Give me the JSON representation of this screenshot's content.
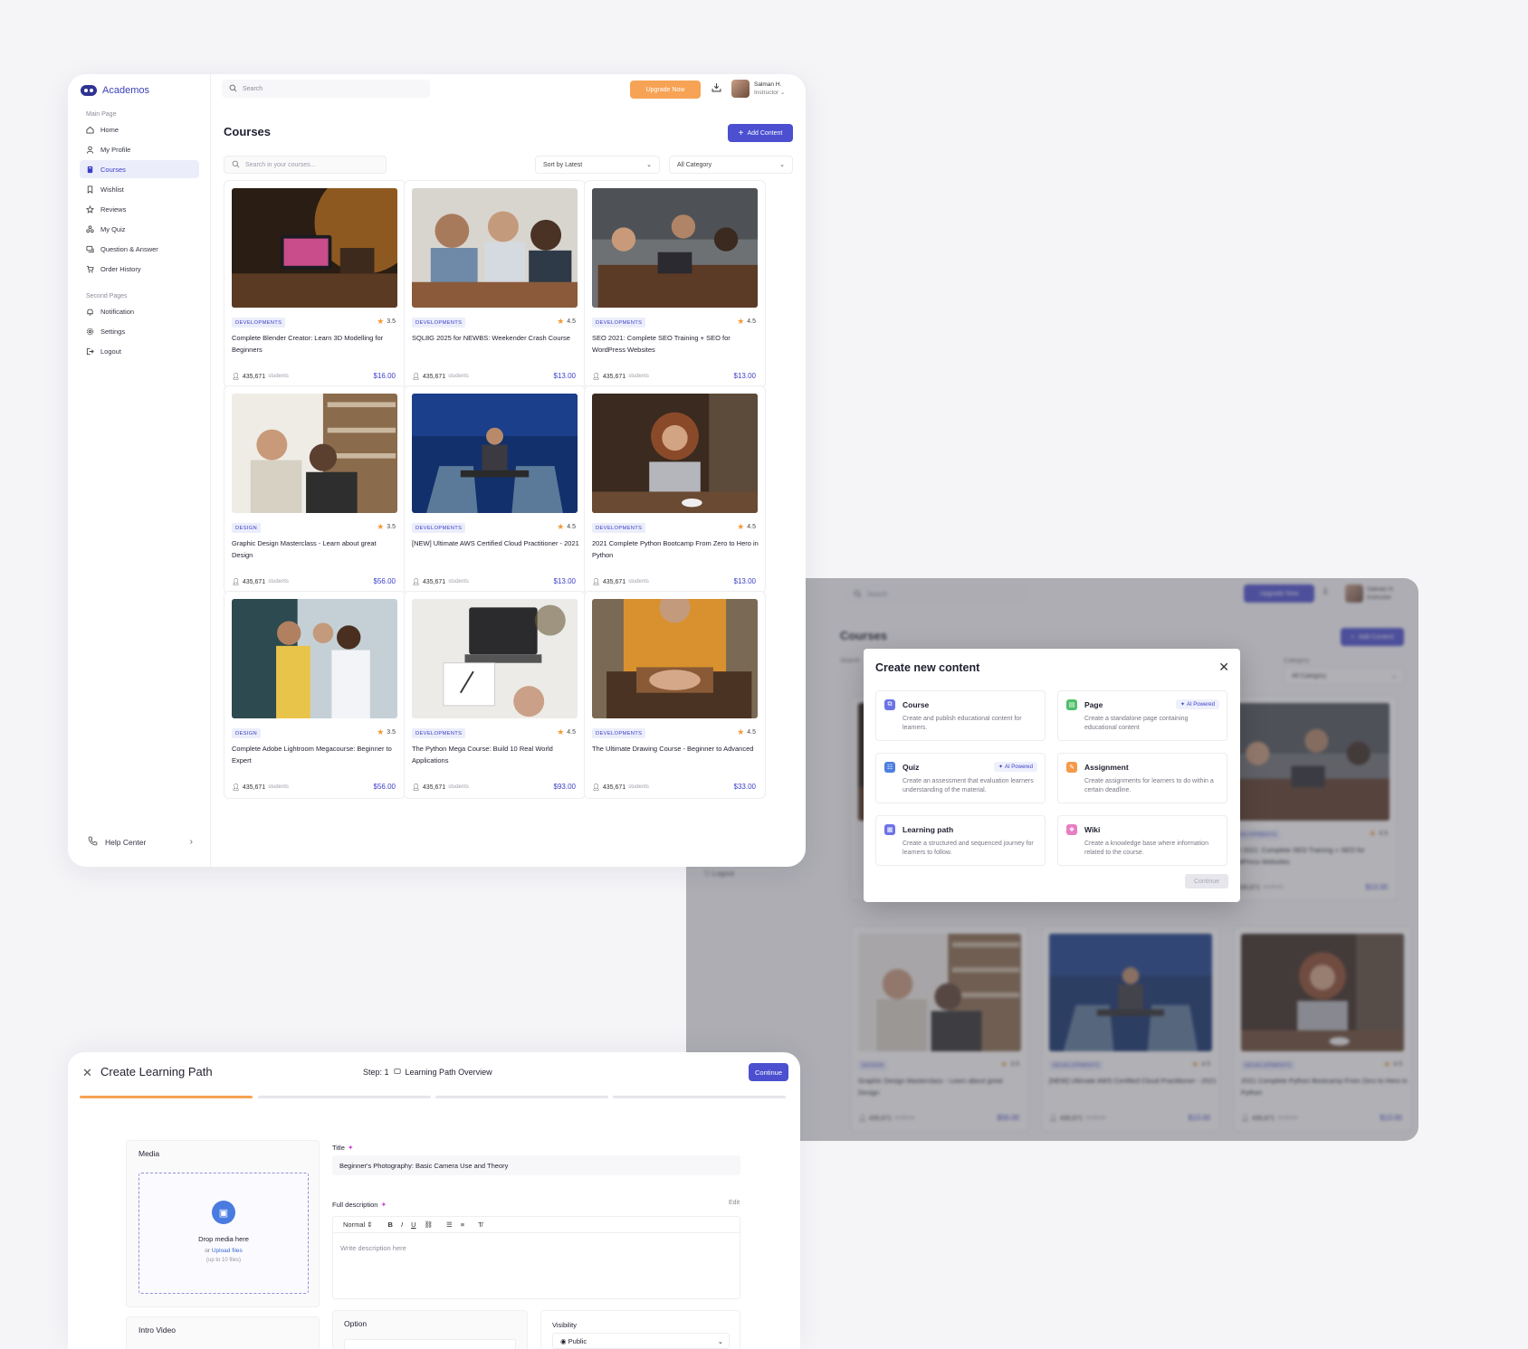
{
  "main": {
    "brand": "Academos",
    "search_placeholder": "Search",
    "upgrade_label": "Upgrade Now",
    "user": {
      "name": "Salman H.",
      "role": "Instructor"
    },
    "sections": {
      "main": "Main Page",
      "second": "Second Pages"
    },
    "nav": [
      "Home",
      "My Profile",
      "Courses",
      "Wishlist",
      "Reviews",
      "My Quiz",
      "Question & Answer",
      "Order History"
    ],
    "nav2": [
      "Notification",
      "Settings",
      "Logout"
    ],
    "help": "Help Center",
    "page_title": "Courses",
    "add_content": "Add Content",
    "course_search_placeholder": "Search in your courses...",
    "sort_label": "Sort by Latest",
    "category_label": "All Category",
    "students_word": "students",
    "courses": [
      {
        "tag": "DEVELOPMENTS",
        "rating": "3.5",
        "title": "Complete Blender Creator: Learn 3D Modelling for Beginners",
        "students": "435,671",
        "price": "$16.00"
      },
      {
        "tag": "DEVELOPMENTS",
        "rating": "4.5",
        "title": "SQL8G 2025 for NEWBS: Weekender Crash Course",
        "students": "435,671",
        "price": "$13.00"
      },
      {
        "tag": "DEVELOPMENTS",
        "rating": "4.5",
        "title": "SEO 2021: Complete SEO Training + SEO for WordPress Websites",
        "students": "435,671",
        "price": "$13.00"
      },
      {
        "tag": "DESIGN",
        "rating": "3.5",
        "title": "Graphic Design Masterclass - Learn about great Design",
        "students": "435,671",
        "price": "$56.00"
      },
      {
        "tag": "DEVELOPMENTS",
        "rating": "4.5",
        "title": "[NEW] Ultimate AWS Certified Cloud Practitioner - 2021",
        "students": "435,671",
        "price": "$13.00"
      },
      {
        "tag": "DEVELOPMENTS",
        "rating": "4.5",
        "title": "2021 Complete Python Bootcamp From Zero to Hero in Python",
        "students": "435,671",
        "price": "$13.00"
      },
      {
        "tag": "DESIGN",
        "rating": "3.5",
        "title": "Complete Adobe Lightroom Megacourse: Beginner to Expert",
        "students": "435,671",
        "price": "$56.00"
      },
      {
        "tag": "DEVELOPMENTS",
        "rating": "4.5",
        "title": "The Python Mega Course: Build 10 Real World Applications",
        "students": "435,671",
        "price": "$93.00"
      },
      {
        "tag": "DEVELOPMENTS",
        "rating": "4.5",
        "title": "The Ultimate Drawing Course - Beginner to Advanced",
        "students": "435,671",
        "price": "$33.00"
      }
    ]
  },
  "right": {
    "search_placeholder": "Search",
    "upgrade_label": "Upgrade Now",
    "user": {
      "name": "Salman H.",
      "role": "Instructor"
    },
    "page_title": "Courses",
    "add_content": "Add Content",
    "search_label": "Search",
    "category_field_label": "Category",
    "category_value": "All Category",
    "logout": "Logout",
    "students_word": "students",
    "cards": [
      {
        "tag": "DEVELOPMENTS",
        "rating": "4.5",
        "title": "SEO 2021: Complete SEO Training + SEO for WordPress Websites",
        "students": "435,671",
        "price": "$13.00"
      },
      {
        "tag": "DESIGN",
        "rating": "3.5",
        "title": "Graphic Design Masterclass - Learn about great Design",
        "students": "435,671",
        "price": "$56.00"
      },
      {
        "tag": "DEVELOPMENTS",
        "rating": "4.5",
        "title": "[NEW] Ultimate AWS Certified Cloud Practitioner - 2021",
        "students": "435,671",
        "price": "$13.00"
      },
      {
        "tag": "DEVELOPMENTS",
        "rating": "4.5",
        "title": "2021 Complete Python Bootcamp From Zero to Hero in Python",
        "students": "435,671",
        "price": "$13.00"
      }
    ],
    "modal": {
      "title": "Create new content",
      "ai_badge": "AI Powered",
      "continue": "Continue",
      "options": [
        {
          "name": "Course",
          "desc": "Create and publish educational content for learners.",
          "color": "#6d73e6"
        },
        {
          "name": "Page",
          "desc": "Create a standalone page containing educational content",
          "color": "#4fbf6a"
        },
        {
          "name": "Quiz",
          "desc": "Create an assessment that evaluation learners understanding of the material.",
          "color": "#4f7fe0"
        },
        {
          "name": "Assignment",
          "desc": "Create assignments for learners to do within a certain deadline.",
          "color": "#f49a4a"
        },
        {
          "name": "Learning path",
          "desc": "Create a structured and sequenced journey for learners to follow.",
          "color": "#6d73e6"
        },
        {
          "name": "Wiki",
          "desc": "Create a knowledge base where information related to the course.",
          "color": "#e77fc4"
        }
      ]
    }
  },
  "bottom": {
    "title": "Create Learning Path",
    "step": "Step: 1",
    "step_name": "Learning Path Overview",
    "continue": "Continue",
    "media_label": "Media",
    "drop_text": "Drop media here",
    "or_text": "or",
    "upload_text": "Upload files",
    "limit_text": "(up to 10 files)",
    "intro_video": "Intro Video",
    "title_label": "Title",
    "title_value": "Beginner's Photography: Basic Camera Use and Theory",
    "desc_label": "Full description",
    "edit_label": "Edit",
    "format_value": "Normal",
    "desc_placeholder": "Write description here",
    "option_label": "Option",
    "visibility_label": "Visibility",
    "visibility_value": "Public"
  },
  "colors": {
    "accent": "#4b4fd0",
    "upgrade": "#f7a355",
    "price": "#3b3fc6"
  }
}
